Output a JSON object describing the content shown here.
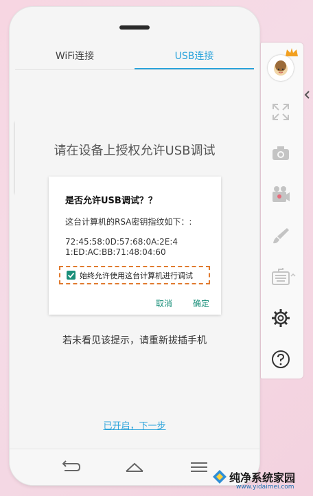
{
  "tabs": {
    "wifi_label": "WiFi连接",
    "usb_label": "USB连接",
    "active": "usb"
  },
  "instruction": "请在设备上授权允许USB调试",
  "dialog": {
    "title": "是否允许USB调试？？",
    "description": "这台计算机的RSA密钥指纹如下：:",
    "fingerprint_line1": "72:45:58:0D:57:68:0A:2E:4",
    "fingerprint_line2": "1:ED:AC:BB:71:48:04:60",
    "checkbox_label": "始终允许使用这台计算机进行调试",
    "checkbox_checked": true,
    "cancel_label": "取消",
    "confirm_label": "确定"
  },
  "hint": "若未看见该提示，请重新拔插手机",
  "next_link": "已开启，下一步",
  "navbar": {
    "icons": [
      "back-icon",
      "home-icon",
      "menu-icon"
    ]
  },
  "sidebar": {
    "icons": [
      "avatar",
      "fullscreen-icon",
      "camera-icon",
      "video-record-icon",
      "brush-icon",
      "keyboard-icon",
      "settings-icon",
      "help-icon"
    ]
  },
  "watermark": {
    "title": "纯净系统家园",
    "url": "www.yidaimei.com"
  },
  "colors": {
    "accent": "#2ba3db",
    "dialog_accent": "#1a8f7a",
    "highlight_border": "#e07a2e",
    "background": "#f5dbe6"
  }
}
